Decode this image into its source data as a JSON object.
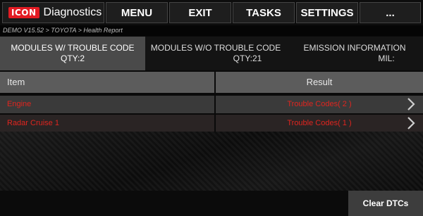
{
  "header": {
    "logo_text": "ICON",
    "app_title": "Diagnostics",
    "nav": [
      "MENU",
      "EXIT",
      "TASKS",
      "SETTINGS",
      "..."
    ]
  },
  "breadcrumb": "DEMO V15.52 > TOYOTA > Health Report",
  "tabs": [
    {
      "line1": "MODULES W/ TROUBLE CODE",
      "line2": "QTY:2",
      "active": true
    },
    {
      "line1": "MODULES W/O TROUBLE CODE",
      "line2": "QTY:21",
      "active": false
    },
    {
      "line1": "EMISSION INFORMATION",
      "line2": "MIL:",
      "active": false
    }
  ],
  "table": {
    "headers": [
      "Item",
      "Result"
    ],
    "rows": [
      {
        "item": "Engine",
        "result": "Trouble Codes( 2 )"
      },
      {
        "item": "Radar Cruise 1",
        "result": "Trouble Codes( 1 )"
      }
    ]
  },
  "footer": {
    "clear_label": "Clear DTCs"
  },
  "colors": {
    "brand_red": "#e31b23",
    "error_text": "#e0251f",
    "active_tab": "#4a4a4a",
    "header_gray": "#5c5c5c"
  }
}
